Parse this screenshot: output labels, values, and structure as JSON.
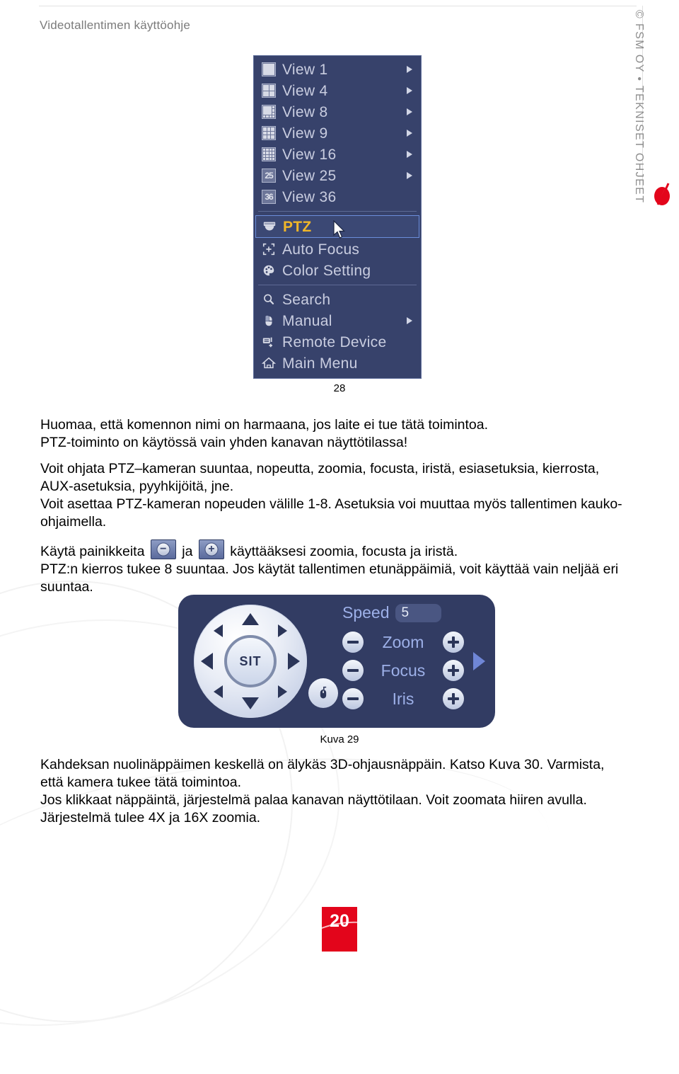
{
  "header": {
    "doc_title": "Videotallentimen käyttöohje"
  },
  "sidebar": {
    "vertical_text": "© FSM OY • TEKNISET OHJEET",
    "logo_name": "fsm-red-logo"
  },
  "context_menu": {
    "items": [
      {
        "label": "View 1",
        "icon": "grid-1-icon",
        "has_submenu": true,
        "selected": false,
        "separator_after": false
      },
      {
        "label": "View 4",
        "icon": "grid-4-icon",
        "has_submenu": true,
        "selected": false,
        "separator_after": false
      },
      {
        "label": "View 8",
        "icon": "grid-8-icon",
        "has_submenu": true,
        "selected": false,
        "separator_after": false
      },
      {
        "label": "View 9",
        "icon": "grid-9-icon",
        "has_submenu": true,
        "selected": false,
        "separator_after": false
      },
      {
        "label": "View 16",
        "icon": "grid-16-icon",
        "has_submenu": true,
        "selected": false,
        "separator_after": false
      },
      {
        "label": "View 25",
        "icon": "grid-25-icon",
        "has_submenu": true,
        "selected": false,
        "separator_after": false
      },
      {
        "label": "View 36",
        "icon": "grid-36-icon",
        "has_submenu": false,
        "selected": false,
        "separator_after": true
      },
      {
        "label": "PTZ",
        "icon": "ptz-camera-icon",
        "has_submenu": false,
        "selected": true,
        "separator_after": false
      },
      {
        "label": "Auto Focus",
        "icon": "auto-focus-icon",
        "has_submenu": false,
        "selected": false,
        "separator_after": false
      },
      {
        "label": "Color Setting",
        "icon": "color-palette-icon",
        "has_submenu": false,
        "selected": false,
        "separator_after": true
      },
      {
        "label": "Search",
        "icon": "magnifier-icon",
        "has_submenu": false,
        "selected": false,
        "separator_after": false
      },
      {
        "label": "Manual",
        "icon": "mouse-icon",
        "has_submenu": true,
        "selected": false,
        "separator_after": false
      },
      {
        "label": "Remote Device",
        "icon": "remote-device-icon",
        "has_submenu": false,
        "selected": false,
        "separator_after": false
      },
      {
        "label": "Main Menu",
        "icon": "home-icon",
        "has_submenu": false,
        "selected": false,
        "separator_after": false
      }
    ],
    "cursor_icon": "mouse-pointer-icon",
    "colors": {
      "background": "#37426b",
      "border": "#5f6e9b",
      "label": "#c9cde0",
      "selected_label": "#f0b629",
      "selected_border": "#6b8ddb"
    }
  },
  "figures": {
    "caption_28": "28",
    "caption_29": "Kuva 29"
  },
  "body": {
    "p1_line1": "Huomaa, että komennon nimi on harmaana, jos laite ei tue tätä toimintoa.",
    "p1_line2": "PTZ-toiminto on käytössä vain yhden kanavan näyttötilassa!",
    "p2_line1": "Voit ohjata PTZ–kameran suuntaa, nopeutta, zoomia, focusta, iristä, esiasetuksia, kierrosta,",
    "p2_line2": "AUX-asetuksia, pyyhkijöitä, jne.",
    "p2_line3": "Voit asettaa PTZ-kameran nopeuden välille 1-8. Asetuksia voi muuttaa myös tallentimen kauko-",
    "p2_line4": "ohjaimella.",
    "p3_prefix": "Käytä painikkeita",
    "p3_mid": "ja",
    "p3_suffix": "käyttääksesi zoomia, focusta ja iristä.",
    "p3_line2": "PTZ:n kierros tukee 8 suuntaa. Jos käytät tallentimen etunäppäimiä, voit käyttää vain neljää eri",
    "p3_line3": "suuntaa.",
    "p4_line1": "Kahdeksan nuolinäppäimen keskellä on älykäs 3D-ohjausnäppäin. Katso Kuva 30. Varmista,",
    "p4_line2": "että kamera tukee tätä toimintoa.",
    "p4_line3": "Jos klikkaat näppäintä, järjestelmä palaa kanavan näyttötilaan. Voit zoomata hiiren avulla.",
    "p4_line4": "Järjestelmä tulee 4X ja 16X zoomia.",
    "inline_minus": "−",
    "inline_plus": "+"
  },
  "ptz_panel": {
    "hub_label": "SIT",
    "speed_label": "Speed",
    "speed_value": "5",
    "rows": [
      {
        "label": "Zoom",
        "minus": "−",
        "plus": "+"
      },
      {
        "label": "Focus",
        "minus": "−",
        "plus": "+"
      },
      {
        "label": "Iris",
        "minus": "−",
        "plus": "+"
      }
    ],
    "colors": {
      "panel_bg": "#323c63",
      "label": "#9db0e8",
      "next_arrow": "#6f86d6"
    }
  },
  "footer": {
    "page_number": "20",
    "accent_color": "#e3051b"
  }
}
